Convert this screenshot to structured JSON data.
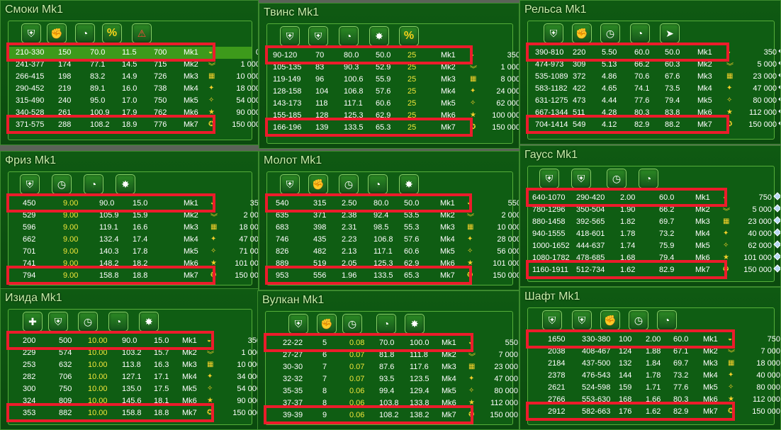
{
  "panels": [
    {
      "title": "Смоки Mk1",
      "icons": [
        "armor-icon",
        "power-icon",
        "speed-icon",
        "critical-chance-icon",
        "critical-damage-icon"
      ],
      "icon_glyphs": [
        "⛨",
        "✊",
        "◔",
        "%",
        "⚠"
      ],
      "rows": [
        {
          "c": [
            "210-330",
            "150",
            "70.0",
            "11.5",
            "700"
          ],
          "mk": "Mk1",
          "price": "0"
        },
        {
          "c": [
            "241-377",
            "174",
            "77.1",
            "14.5",
            "715"
          ],
          "mk": "Mk2",
          "price": "1 000"
        },
        {
          "c": [
            "266-415",
            "198",
            "83.2",
            "14.9",
            "726"
          ],
          "mk": "Mk3",
          "price": "10 000"
        },
        {
          "c": [
            "290-452",
            "219",
            "89.1",
            "16.0",
            "738"
          ],
          "mk": "Mk4",
          "price": "18 000"
        },
        {
          "c": [
            "315-490",
            "240",
            "95.0",
            "17.0",
            "750"
          ],
          "mk": "Mk5",
          "price": "54 000"
        },
        {
          "c": [
            "340-528",
            "261",
            "100.9",
            "17.9",
            "762"
          ],
          "mk": "Mk6",
          "price": "90 000"
        },
        {
          "c": [
            "371-575",
            "288",
            "108.2",
            "18.9",
            "776"
          ],
          "mk": "Mk7",
          "price": "150 000"
        }
      ]
    },
    {
      "title": "Твинс Mk1",
      "icons": [
        "armor-icon",
        "damage-icon",
        "speed-icon",
        "range-icon",
        "critical-icon"
      ],
      "icon_glyphs": [
        "⛨",
        "⛨",
        "◔",
        "✸",
        "%"
      ],
      "rows": [
        {
          "c": [
            "90-120",
            "70",
            "80.0",
            "50.0",
            "25"
          ],
          "mk": "Mk1",
          "price": "350"
        },
        {
          "c": [
            "105-135",
            "83",
            "90.3",
            "52.9",
            "25"
          ],
          "mk": "Mk2",
          "price": "1 000"
        },
        {
          "c": [
            "119-149",
            "96",
            "100.6",
            "55.9",
            "25"
          ],
          "mk": "Mk3",
          "price": "8 000"
        },
        {
          "c": [
            "128-158",
            "104",
            "106.8",
            "57.6",
            "25"
          ],
          "mk": "Mk4",
          "price": "24 000"
        },
        {
          "c": [
            "143-173",
            "118",
            "117.1",
            "60.6",
            "25"
          ],
          "mk": "Mk5",
          "price": "62 000"
        },
        {
          "c": [
            "155-185",
            "128",
            "125.3",
            "62.9",
            "25"
          ],
          "mk": "Mk6",
          "price": "100 000"
        },
        {
          "c": [
            "166-196",
            "139",
            "133.5",
            "65.3",
            "25"
          ],
          "mk": "Mk7",
          "price": "150 000"
        }
      ]
    },
    {
      "title": "Рельса Mk1",
      "icons": [
        "armor-icon",
        "power-icon",
        "reload-icon",
        "speed-icon",
        "shot-icon"
      ],
      "icon_glyphs": [
        "⛨",
        "✊",
        "◷",
        "◔",
        "➤"
      ],
      "rows": [
        {
          "c": [
            "390-810",
            "220",
            "5.50",
            "60.0",
            "50.0"
          ],
          "mk": "Mk1",
          "price": "350"
        },
        {
          "c": [
            "474-973",
            "309",
            "5.13",
            "66.2",
            "60.3"
          ],
          "mk": "Mk2",
          "price": "5 000"
        },
        {
          "c": [
            "535-1089",
            "372",
            "4.86",
            "70.6",
            "67.6"
          ],
          "mk": "Mk3",
          "price": "23 000"
        },
        {
          "c": [
            "583-1182",
            "422",
            "4.65",
            "74.1",
            "73.5"
          ],
          "mk": "Mk4",
          "price": "47 000"
        },
        {
          "c": [
            "631-1275",
            "473",
            "4.44",
            "77.6",
            "79.4"
          ],
          "mk": "Mk5",
          "price": "80 000"
        },
        {
          "c": [
            "667-1344",
            "511",
            "4.28",
            "80.3",
            "83.8"
          ],
          "mk": "Mk6",
          "price": "112 000"
        },
        {
          "c": [
            "704-1414",
            "549",
            "4.12",
            "82.9",
            "88.2"
          ],
          "mk": "Mk7",
          "price": "150 000"
        }
      ]
    },
    {
      "title": "Фриз Mk1",
      "icons": [
        "armor-icon",
        "reload-icon",
        "speed-icon",
        "range-icon"
      ],
      "icon_glyphs": [
        "⛨",
        "◷",
        "◔",
        "✸"
      ],
      "rows": [
        {
          "c": [
            "450",
            "9.00",
            "90.0",
            "15.0"
          ],
          "mk": "Mk1",
          "price": "350"
        },
        {
          "c": [
            "529",
            "9.00",
            "105.9",
            "15.9"
          ],
          "mk": "Mk2",
          "price": "2 000"
        },
        {
          "c": [
            "596",
            "9.00",
            "119.1",
            "16.6"
          ],
          "mk": "Mk3",
          "price": "18 000"
        },
        {
          "c": [
            "662",
            "9.00",
            "132.4",
            "17.4"
          ],
          "mk": "Mk4",
          "price": "47 000"
        },
        {
          "c": [
            "701",
            "9.00",
            "140.3",
            "17.8"
          ],
          "mk": "Mk5",
          "price": "71 000"
        },
        {
          "c": [
            "741",
            "9.00",
            "148.2",
            "18.2"
          ],
          "mk": "Mk6",
          "price": "101 000"
        },
        {
          "c": [
            "794",
            "9.00",
            "158.8",
            "18.8"
          ],
          "mk": "Mk7",
          "price": "150 000"
        }
      ]
    },
    {
      "title": "Молот Mk1",
      "icons": [
        "armor-icon",
        "power-icon",
        "reload-icon",
        "speed-icon",
        "range-icon"
      ],
      "icon_glyphs": [
        "⛨",
        "✊",
        "◷",
        "◔",
        "✸"
      ],
      "rows": [
        {
          "c": [
            "540",
            "315",
            "2.50",
            "80.0",
            "50.0"
          ],
          "mk": "Mk1",
          "price": "550"
        },
        {
          "c": [
            "635",
            "371",
            "2.38",
            "92.4",
            "53.5"
          ],
          "mk": "Mk2",
          "price": "2 000"
        },
        {
          "c": [
            "683",
            "398",
            "2.31",
            "98.5",
            "55.3"
          ],
          "mk": "Mk3",
          "price": "10 000"
        },
        {
          "c": [
            "746",
            "435",
            "2.23",
            "106.8",
            "57.6"
          ],
          "mk": "Mk4",
          "price": "28 000"
        },
        {
          "c": [
            "826",
            "482",
            "2.13",
            "117.1",
            "60.6"
          ],
          "mk": "Mk5",
          "price": "56 000"
        },
        {
          "c": [
            "889",
            "519",
            "2.05",
            "125.3",
            "62.9"
          ],
          "mk": "Mk6",
          "price": "101 000"
        },
        {
          "c": [
            "953",
            "556",
            "1.96",
            "133.5",
            "65.3"
          ],
          "mk": "Mk7",
          "price": "150 000"
        }
      ]
    },
    {
      "title": "Гаусс Mk1",
      "icons": [
        "armor-icon",
        "armor-icon",
        "reload-icon",
        "speed-icon"
      ],
      "icon_glyphs": [
        "⛨",
        "⛨",
        "◷",
        "◔"
      ],
      "rows": [
        {
          "c": [
            "640-1070",
            "290-420",
            "2.00",
            "60.0"
          ],
          "mk": "Mk1",
          "price": "750"
        },
        {
          "c": [
            "780-1296",
            "350-504",
            "1.90",
            "66.2"
          ],
          "mk": "Mk2",
          "price": "5 000"
        },
        {
          "c": [
            "880-1458",
            "392-565",
            "1.82",
            "69.7"
          ],
          "mk": "Mk3",
          "price": "23 000"
        },
        {
          "c": [
            "940-1555",
            "418-601",
            "1.78",
            "73.2"
          ],
          "mk": "Mk4",
          "price": "40 000"
        },
        {
          "c": [
            "1000-1652",
            "444-637",
            "1.74",
            "75.9"
          ],
          "mk": "Mk5",
          "price": "62 000"
        },
        {
          "c": [
            "1080-1782",
            "478-685",
            "1.68",
            "79.4"
          ],
          "mk": "Mk6",
          "price": "101 000"
        },
        {
          "c": [
            "1160-1911",
            "512-734",
            "1.62",
            "82.9"
          ],
          "mk": "Mk7",
          "price": "150 000"
        }
      ]
    },
    {
      "title": "Изида Mk1",
      "icons": [
        "heal-icon",
        "drain-icon",
        "reload-icon",
        "speed-icon",
        "range-icon"
      ],
      "icon_glyphs": [
        "✚",
        "⛨",
        "◷",
        "◔",
        "✸"
      ],
      "rows": [
        {
          "c": [
            "200",
            "500",
            "10.00",
            "90.0",
            "15.0"
          ],
          "mk": "Mk1",
          "price": "350"
        },
        {
          "c": [
            "229",
            "574",
            "10.00",
            "103.2",
            "15.7"
          ],
          "mk": "Mk2",
          "price": "1 000"
        },
        {
          "c": [
            "253",
            "632",
            "10.00",
            "113.8",
            "16.3"
          ],
          "mk": "Mk3",
          "price": "10 000"
        },
        {
          "c": [
            "282",
            "706",
            "10.00",
            "127.1",
            "17.1"
          ],
          "mk": "Mk4",
          "price": "34 000"
        },
        {
          "c": [
            "300",
            "750",
            "10.00",
            "135.0",
            "17.5"
          ],
          "mk": "Mk5",
          "price": "54 000"
        },
        {
          "c": [
            "324",
            "809",
            "10.00",
            "145.6",
            "18.1"
          ],
          "mk": "Mk6",
          "price": "90 000"
        },
        {
          "c": [
            "353",
            "882",
            "10.00",
            "158.8",
            "18.8"
          ],
          "mk": "Mk7",
          "price": "150 000"
        }
      ]
    },
    {
      "title": "Вулкан Mk1",
      "icons": [
        "armor-icon",
        "power-icon",
        "reload-icon",
        "speed-icon",
        "range-icon"
      ],
      "icon_glyphs": [
        "⛨",
        "✊",
        "◷",
        "◔",
        "✸"
      ],
      "rows": [
        {
          "c": [
            "22-22",
            "5",
            "0.08",
            "70.0",
            "100.0"
          ],
          "mk": "Mk1",
          "price": "550"
        },
        {
          "c": [
            "27-27",
            "6",
            "0.07",
            "81.8",
            "111.8"
          ],
          "mk": "Mk2",
          "price": "7 000"
        },
        {
          "c": [
            "30-30",
            "7",
            "0.07",
            "87.6",
            "117.6"
          ],
          "mk": "Mk3",
          "price": "23 000"
        },
        {
          "c": [
            "32-32",
            "7",
            "0.07",
            "93.5",
            "123.5"
          ],
          "mk": "Mk4",
          "price": "47 000"
        },
        {
          "c": [
            "35-35",
            "8",
            "0.06",
            "99.4",
            "129.4"
          ],
          "mk": "Mk5",
          "price": "80 000"
        },
        {
          "c": [
            "37-37",
            "8",
            "0.06",
            "103.8",
            "133.8"
          ],
          "mk": "Mk6",
          "price": "112 000"
        },
        {
          "c": [
            "39-39",
            "9",
            "0.06",
            "108.2",
            "138.2"
          ],
          "mk": "Mk7",
          "price": "150 000"
        }
      ]
    },
    {
      "title": "Шафт Mk1",
      "icons": [
        "armor-icon",
        "armor-icon",
        "power-icon",
        "reload-icon",
        "speed-icon"
      ],
      "icon_glyphs": [
        "⛨",
        "⛨",
        "✊",
        "◷",
        "◔"
      ],
      "rows": [
        {
          "c": [
            "1650",
            "330-380",
            "100",
            "2.00",
            "60.0"
          ],
          "mk": "Mk1",
          "price": "750"
        },
        {
          "c": [
            "2038",
            "408-467",
            "124",
            "1.88",
            "67.1"
          ],
          "mk": "Mk2",
          "price": "7 000"
        },
        {
          "c": [
            "2184",
            "437-500",
            "132",
            "1.84",
            "69.7"
          ],
          "mk": "Mk3",
          "price": "18 000"
        },
        {
          "c": [
            "2378",
            "476-543",
            "144",
            "1.78",
            "73.2"
          ],
          "mk": "Mk4",
          "price": "40 000"
        },
        {
          "c": [
            "2621",
            "524-598",
            "159",
            "1.71",
            "77.6"
          ],
          "mk": "Mk5",
          "price": "80 000"
        },
        {
          "c": [
            "2766",
            "553-630",
            "168",
            "1.66",
            "80.3"
          ],
          "mk": "Mk6",
          "price": "112 000"
        },
        {
          "c": [
            "2912",
            "582-663",
            "176",
            "1.62",
            "82.9"
          ],
          "mk": "Mk7",
          "price": "150 000"
        }
      ]
    }
  ],
  "rank_glyphs": [
    "◒",
    "︾",
    "▦",
    "✦",
    "✧",
    "★",
    "✪"
  ],
  "colors": {
    "panel_bg": "#0f5a12",
    "selected_row": "#3d9a1b",
    "highlight_red": "#ec1c2b",
    "yellow_value": "#f1e63a",
    "title": "#c7f0a8"
  }
}
